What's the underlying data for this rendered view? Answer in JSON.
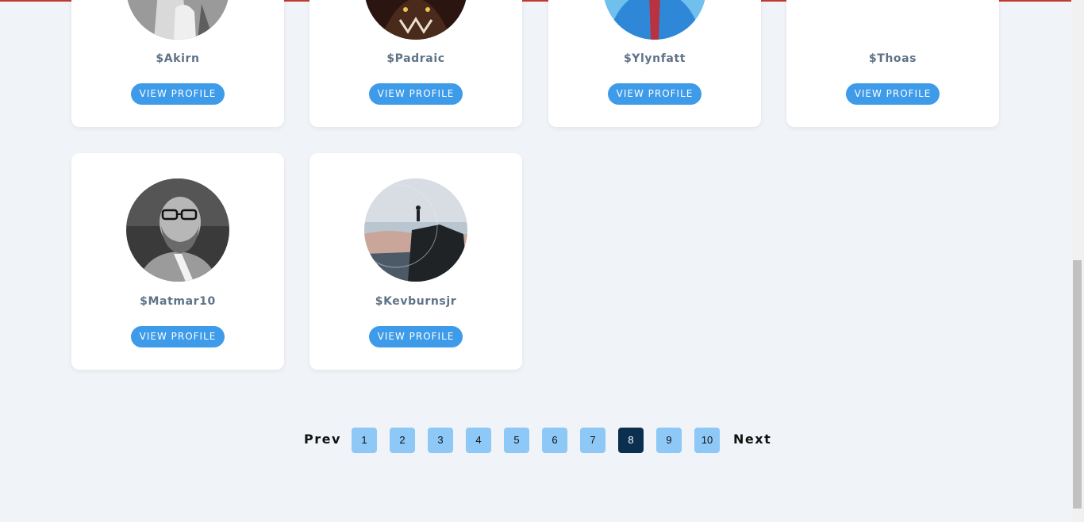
{
  "profiles": [
    {
      "username": "$Akirn",
      "button_label": "VIEW PROFILE"
    },
    {
      "username": "$Padraic",
      "button_label": "VIEW PROFILE"
    },
    {
      "username": "$Ylynfatt",
      "button_label": "VIEW PROFILE"
    },
    {
      "username": "$Thoas",
      "button_label": "VIEW PROFILE"
    },
    {
      "username": "$Matmar10",
      "button_label": "VIEW PROFILE"
    },
    {
      "username": "$Kevburnsjr",
      "button_label": "VIEW PROFILE"
    }
  ],
  "pagination": {
    "prev_label": "Prev",
    "next_label": "Next",
    "pages": [
      "1",
      "2",
      "3",
      "4",
      "5",
      "6",
      "7",
      "8",
      "9",
      "10"
    ],
    "current_page": "8"
  },
  "colors": {
    "accent_button": "#3d9be9",
    "page_chip": "#8dc8f6",
    "active_page_chip": "#0b2f4f",
    "username_text": "#5f7387",
    "top_border": "#c0392b"
  }
}
